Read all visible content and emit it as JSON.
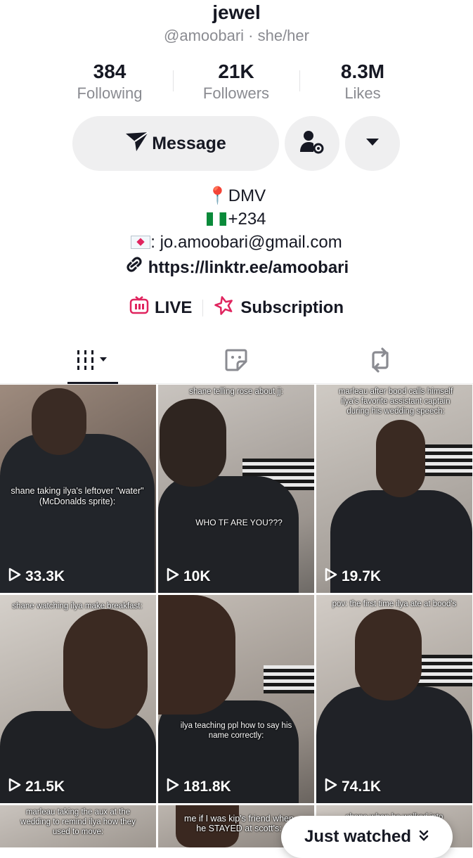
{
  "profile": {
    "name": "jewel",
    "handle": "@amoobari · she/her"
  },
  "stats": [
    {
      "value": "384",
      "label": "Following"
    },
    {
      "value": "21K",
      "label": "Followers"
    },
    {
      "value": "8.3M",
      "label": "Likes"
    }
  ],
  "actions": {
    "message_label": "Message"
  },
  "bio": {
    "location": "DMV",
    "phone": "+234",
    "email": ": jo.amoobari@gmail.com",
    "link": "https://linktr.ee/amoobari"
  },
  "features": {
    "live_label": "LIVE",
    "subscription_label": "Subscription"
  },
  "colors": {
    "accent": "#e0245e",
    "text": "#161823",
    "muted": "#8a8b91",
    "button_bg": "#efeff0"
  },
  "videos": [
    {
      "views": "33.3K",
      "caption": "shane taking ilya's leftover \"water\" (McDonalds sprite):",
      "caption2": ""
    },
    {
      "views": "10K",
      "caption": "shane telling rose about jj:",
      "caption2": "WHO TF ARE YOU???"
    },
    {
      "views": "19.7K",
      "caption": "marleau after bood calls himself ilya's favorite assistant captain during his wedding speech:",
      "caption2": ""
    },
    {
      "views": "21.5K",
      "caption": "shane watching ilya make breakfast:",
      "caption2": ""
    },
    {
      "views": "181.8K",
      "caption": "ilya teaching ppl how to say his name correctly:",
      "caption2": ""
    },
    {
      "views": "74.1K",
      "caption": "pov: the first time ilya ate at bood's",
      "caption2": ""
    },
    {
      "views": "",
      "caption": "marleau taking the aux at the wedding to remind ilya how they used to move:",
      "caption2": ""
    },
    {
      "views": "",
      "caption": "me if I was kip's friend when he STAYED at scott's:",
      "caption2": ""
    },
    {
      "views": "",
      "caption": "shane when he walked into",
      "caption2": ""
    }
  ],
  "just_watched": {
    "label": "Just watched"
  }
}
